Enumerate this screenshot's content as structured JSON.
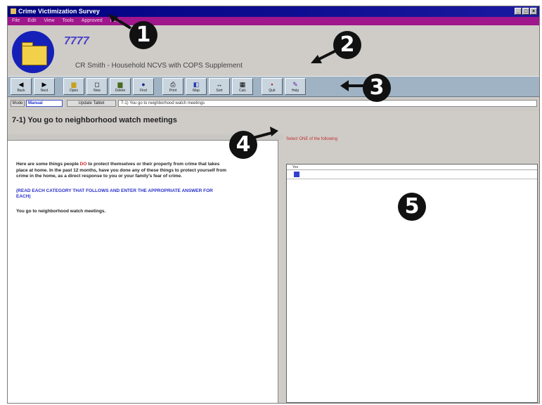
{
  "window": {
    "title": "Crime Victimization Survey"
  },
  "menu": [
    "File",
    "Edit",
    "View",
    "Tools",
    "Approved",
    "Help"
  ],
  "header": {
    "case_id": "7777",
    "subtitle": "CR Smith  -  Household NCVS with COPS Supplement"
  },
  "toolbar": [
    {
      "label": "Back",
      "icon": "back-arrow-icon"
    },
    {
      "label": "Next",
      "icon": "next-arrow-icon"
    },
    {
      "label": "Open",
      "icon": "open-icon"
    },
    {
      "label": "New",
      "icon": "new-icon"
    },
    {
      "label": "Delete",
      "icon": "delete-icon"
    },
    {
      "label": "Find",
      "icon": "find-icon"
    },
    {
      "label": "Print",
      "icon": "print-icon"
    },
    {
      "label": "Map",
      "icon": "map-icon"
    },
    {
      "label": "Sort",
      "icon": "sort-icon"
    },
    {
      "label": "Calc",
      "icon": "calc-icon"
    },
    {
      "label": "Quit",
      "icon": "quit-icon"
    },
    {
      "label": "Help",
      "icon": "help-icon"
    }
  ],
  "mode": {
    "label": "Mode",
    "value": "Manual",
    "update_label": "Update Tablet",
    "question_selector": "7-1) You go to neighborhood watch meetings"
  },
  "question": {
    "title": "7-1) You go to neighborhood watch meetings",
    "intro_before": "Here are some things people ",
    "intro_highlight": "DO",
    "intro_after": " to protect themselves or their property from crime that takes place at home. In the past 12 months, have you done any of these things to protect yourself from crime in the home, as a direct response to you or your family's fear of crime.",
    "instruction": "(READ EACH CATEGORY THAT FOLLOWS AND ENTER THE APPROPRIATE ANSWER FOR EACH)",
    "repeat": "You go to neighborhood watch meetings."
  },
  "answers": {
    "prompt": "Select ONE of the following",
    "header": "Yes"
  },
  "callouts": [
    "1",
    "2",
    "3",
    "4",
    "5"
  ]
}
